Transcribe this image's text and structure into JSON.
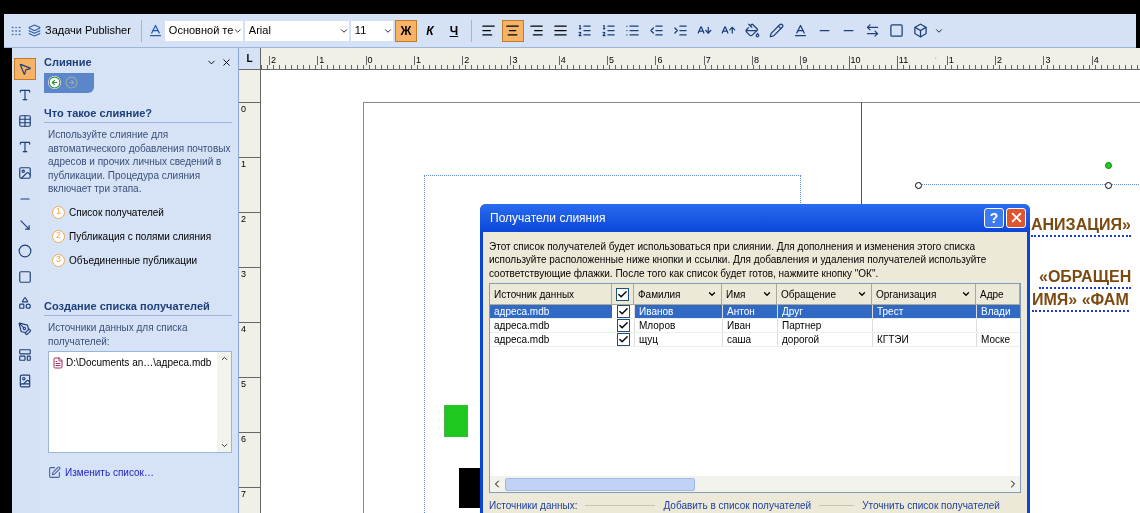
{
  "toolbar": {
    "task_button": "Задачи Publisher",
    "style_field": "Основной те",
    "font_field": "Arial",
    "size_field": "11",
    "format_buttons": [
      {
        "label": "Ж",
        "kind": "bold",
        "selected": true
      },
      {
        "label": "К",
        "kind": "italic",
        "selected": false
      },
      {
        "label": "Ч",
        "kind": "underline",
        "selected": false
      }
    ],
    "align_buttons": [
      {
        "kind": "left",
        "selected": false
      },
      {
        "kind": "center",
        "selected": true
      },
      {
        "kind": "right",
        "selected": false
      },
      {
        "kind": "justify",
        "selected": false
      }
    ]
  },
  "toolbox": [
    {
      "kind": "pointer",
      "selected": true
    },
    {
      "kind": "textbox",
      "selected": false
    },
    {
      "kind": "table",
      "selected": false
    },
    {
      "kind": "wordart",
      "selected": false
    },
    {
      "kind": "picture",
      "selected": false
    },
    {
      "kind": "line",
      "selected": false
    },
    {
      "kind": "arrow",
      "selected": false
    },
    {
      "kind": "oval",
      "selected": false
    },
    {
      "kind": "rectangle",
      "selected": false
    },
    {
      "kind": "shapes",
      "selected": false
    },
    {
      "kind": "pen",
      "selected": false
    },
    {
      "kind": "gallery",
      "selected": false
    },
    {
      "kind": "catalog",
      "selected": false
    }
  ],
  "task_pane": {
    "title": "Слияние",
    "section_1": {
      "heading": "Что такое слияние?",
      "text": "Используйте слияние для автоматического добавления почтовых адресов и прочих личных сведений в публикации. Процедура слияния включает три этапа.",
      "steps": [
        {
          "number": "1",
          "label": "Список получателей"
        },
        {
          "number": "2",
          "label": "Публикация с полями слияния"
        },
        {
          "number": "3",
          "label": "Объединенные публикации"
        }
      ]
    },
    "section_2": {
      "heading": "Создание списка получателей",
      "label": "Источники данных для списка получателей:",
      "files": [
        "D:\\Documents an…\\адреса.mdb"
      ],
      "edit_link": "Изменить список…"
    }
  },
  "ruler": {
    "corner": "L",
    "top_labels": [
      "2",
      "1",
      "0",
      "1",
      "2",
      "3",
      "4",
      "5",
      "6",
      "7",
      "8",
      "9",
      "10",
      "11",
      "1",
      "2",
      "3",
      "4"
    ],
    "side_labels": [
      "0",
      "1",
      "2",
      "3",
      "4",
      "5",
      "6",
      "7"
    ]
  },
  "page": {
    "field_lines": [
      "АНИЗАЦИЯ»",
      "«ОБРАЩЕН",
      "ИМЯ» «ФАМ"
    ]
  },
  "dialog": {
    "title": "Получатели слияния",
    "help": "?",
    "description": "Этот список получателей будет использоваться при слиянии. Для дополнения и изменения этого списка используйте расположенные ниже кнопки и ссылки. Для добавления и удаления получателей используйте соответствующие флажки. После того как список будет готов, нажмите кнопку \"ОК\".",
    "header_checked": true,
    "columns": [
      "Источник данных",
      "Фамилия",
      "Имя",
      "Обращение",
      "Организация",
      "Адре"
    ],
    "rows": [
      {
        "selected": true,
        "checked": true,
        "cells": [
          "адреса.mdb",
          "Иванов",
          "Антон",
          "Друг",
          "Трест",
          "Влади"
        ]
      },
      {
        "selected": false,
        "checked": true,
        "cells": [
          "адреса.mdb",
          "Млоров",
          "Иван",
          "Партнер",
          "",
          ""
        ]
      },
      {
        "selected": false,
        "checked": true,
        "cells": [
          "адреса.mdb",
          "щуц",
          "саша",
          "дорогой",
          "КГТЭИ",
          "Моске"
        ]
      }
    ],
    "footer": [
      "Источники данных:",
      "Добавить в список получателей",
      "Уточнить список получателей"
    ]
  }
}
